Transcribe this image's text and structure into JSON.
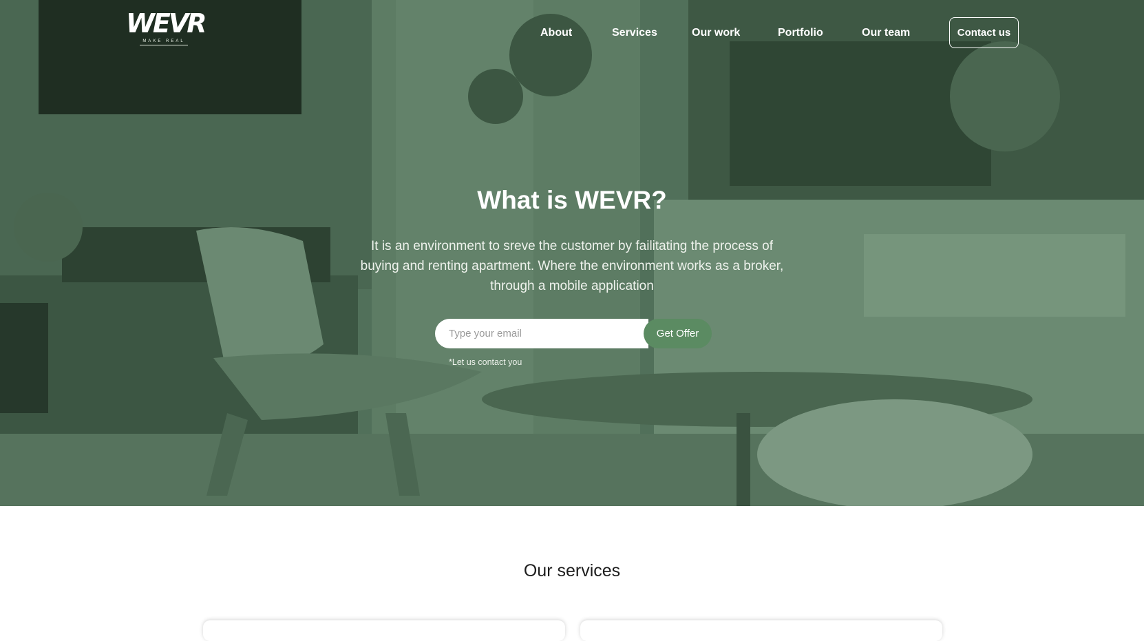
{
  "brand": {
    "logo_text": "WEVR",
    "tagline": "MAKE REAL"
  },
  "nav": {
    "items": [
      "About",
      "Services",
      "Our work",
      "Portfolio",
      "Our team"
    ],
    "contact_label": "Contact us"
  },
  "hero": {
    "title": "What is WEVR?",
    "description": "It is an environment to sreve the customer by failitating the process of buying and renting apartment. Where the environment works as a broker, through a mobile application",
    "email_placeholder": "Type your email",
    "offer_button": "Get Offer",
    "note": "*Let us contact you"
  },
  "services": {
    "title": "Our services"
  },
  "colors": {
    "overlay": "#4e6b55",
    "accent": "#5b8b62",
    "logo_accent": "#c6e0a8"
  }
}
